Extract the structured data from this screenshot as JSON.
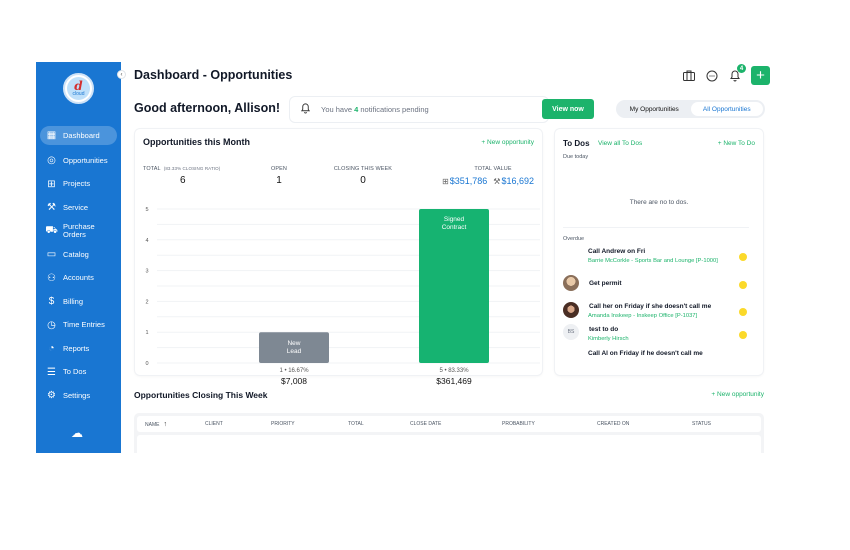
{
  "sidebar": {
    "logo_text": "cloud",
    "items": [
      {
        "label": "Dashboard",
        "icon": "grid-icon",
        "glyph": "▦",
        "active": true
      },
      {
        "label": "Opportunities",
        "icon": "target-icon",
        "glyph": "◎"
      },
      {
        "label": "Projects",
        "icon": "briefcase-icon",
        "glyph": "⊞"
      },
      {
        "label": "Service",
        "icon": "wrench-icon",
        "glyph": "⚒"
      },
      {
        "label": "Purchase Orders",
        "icon": "cart-icon",
        "glyph": "⛟"
      },
      {
        "label": "Catalog",
        "icon": "book-icon",
        "glyph": "▭"
      },
      {
        "label": "Accounts",
        "icon": "users-icon",
        "glyph": "⚇"
      },
      {
        "label": "Billing",
        "icon": "dollar-icon",
        "glyph": "$"
      },
      {
        "label": "Time Entries",
        "icon": "clock-icon",
        "glyph": "◷"
      },
      {
        "label": "Reports",
        "icon": "pie-chart-icon",
        "glyph": "◔"
      },
      {
        "label": "To Dos",
        "icon": "list-icon",
        "glyph": "☰"
      },
      {
        "label": "Settings",
        "icon": "gear-icon",
        "glyph": "⚙"
      }
    ]
  },
  "header": {
    "title": "Dashboard - Opportunities",
    "notification_badge": "4",
    "add_label": "+"
  },
  "greeting": "Good afternoon, Allison!",
  "notifications": {
    "prefix": "You have ",
    "count": "4",
    "suffix": " notifications pending",
    "button": "View now"
  },
  "toggle": {
    "options": [
      "My Opportunities",
      "All Opportunities"
    ],
    "selected": "All Opportunities"
  },
  "opportunities_month": {
    "title": "Opportunities this Month",
    "new_link": "+ New opportunity",
    "stats": {
      "total_label": "TOTAL",
      "total_sub": "(83.33% CLOSING RATIO)",
      "total": "6",
      "open_label": "OPEN",
      "open": "1",
      "closing_label": "CLOSING THIS WEEK",
      "closing": "0",
      "value_label": "TOTAL VALUE",
      "value_projects": "$351,786",
      "value_service": "$16,692"
    }
  },
  "chart_data": {
    "type": "bar",
    "title": "",
    "xlabel": "",
    "ylabel": "",
    "ylim": [
      0,
      5
    ],
    "yticks": [
      "0",
      "1",
      "2",
      "3",
      "4",
      "5"
    ],
    "grid": true,
    "categories": [
      "New Lead",
      "Signed Contract"
    ],
    "bar_labels": [
      [
        "New",
        "Lead"
      ],
      [
        "Signed",
        "Contract"
      ]
    ],
    "values": [
      1,
      5
    ],
    "percent_labels": [
      "1 • 16.67%",
      "5 • 83.33%"
    ],
    "amount_labels": [
      "$7,008",
      "$361,469"
    ],
    "colors": [
      "#7e8893",
      "#16b371"
    ]
  },
  "todos": {
    "title": "To Dos",
    "view_all": "View all To Dos",
    "new": "+ New To Do",
    "due_today": "Due today",
    "empty": "There are no to dos.",
    "overdue": "Overdue",
    "items": [
      {
        "name": "Call Andrew on Fri",
        "sub": "Barrie McCorkle - Sports Bar and Lounge [P-1000]",
        "avatar": ""
      },
      {
        "name": "Get permit",
        "sub": "",
        "avatar": "photo"
      },
      {
        "name": "Call her on Friday if she doesn't call me",
        "sub": "Amanda Inskeep - Inskeep Office [P-1037]",
        "avatar": "photo"
      },
      {
        "name": "test to do",
        "sub": "Kimberly Hirsch",
        "avatar": "BS"
      },
      {
        "name": "Call Al on Friday if he doesn't call me",
        "sub": "",
        "avatar": ""
      }
    ]
  },
  "closing_week": {
    "title": "Opportunities Closing This Week",
    "new_link": "+ New opportunity",
    "columns": [
      "NAME",
      "CLIENT",
      "PRIORITY",
      "TOTAL",
      "CLOSE DATE",
      "PROBABILITY",
      "CREATED ON",
      "STATUS"
    ],
    "sort_indicator": "↑"
  },
  "colors": {
    "sidebar": "#1976d2",
    "accent_green": "#1cb36b",
    "link_blue": "#1976d2",
    "todo_dot": "#fbd92a"
  }
}
